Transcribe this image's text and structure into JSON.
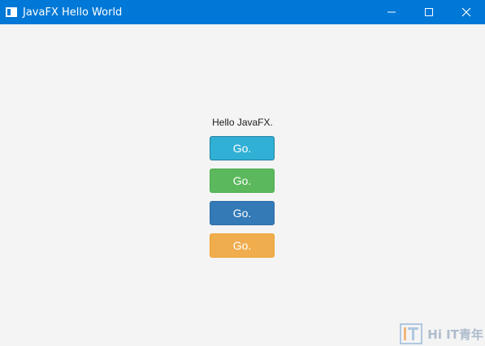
{
  "window": {
    "title": "JavaFX Hello World"
  },
  "content": {
    "label": "Hello JavaFX.",
    "buttons": [
      {
        "label": "Go.",
        "style": "info",
        "color": "#30b0d5"
      },
      {
        "label": "Go.",
        "style": "success",
        "color": "#5cb85c"
      },
      {
        "label": "Go.",
        "style": "primary",
        "color": "#337ab7"
      },
      {
        "label": "Go.",
        "style": "warning",
        "color": "#f0ad4e"
      }
    ]
  },
  "colors": {
    "titlebar": "#0078d7",
    "background": "#f4f4f4"
  },
  "icons": {
    "app": "app-window-icon",
    "minimize": "minimize-icon",
    "maximize": "maximize-icon",
    "close": "close-icon"
  },
  "watermark": {
    "text": "Hi IT青年"
  }
}
